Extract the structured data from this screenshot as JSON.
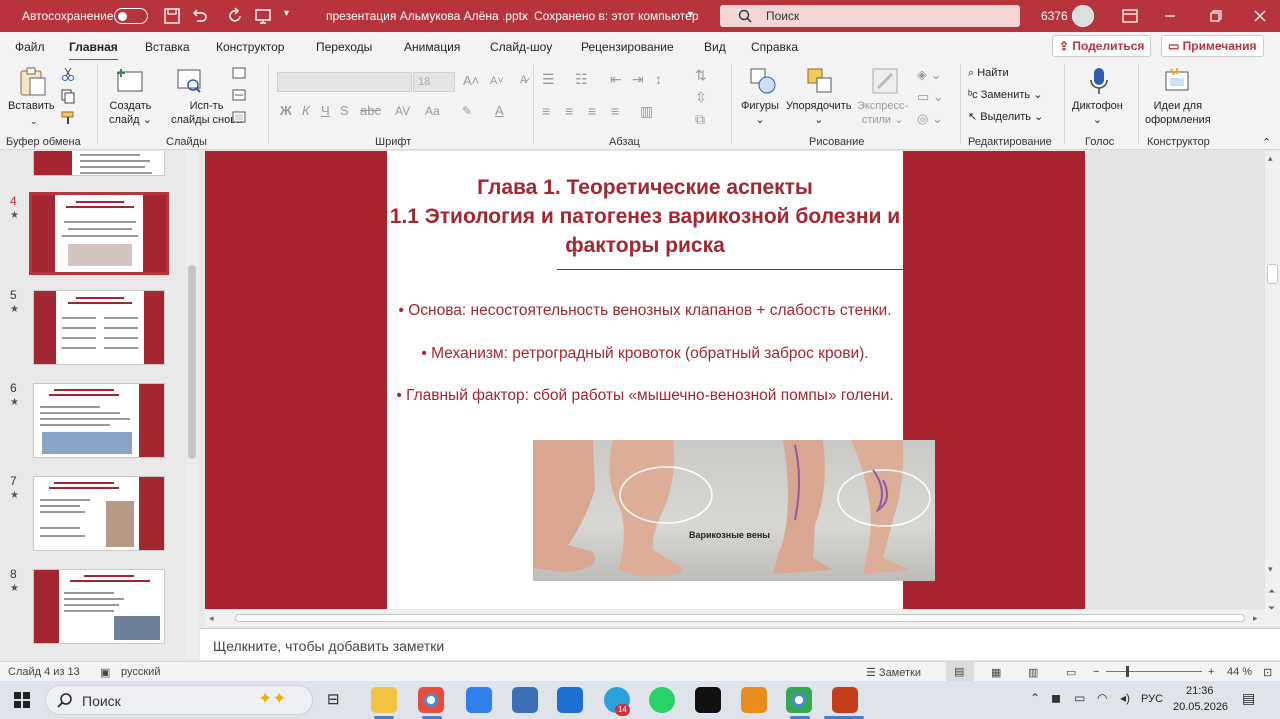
{
  "titlebar": {
    "autosave_label": "Автосохранение",
    "file_title": "презентация Альмукова Алёна .pptx",
    "save_status": "Сохранено в: этот компьютер",
    "search_placeholder": "Поиск",
    "user_count": "6376"
  },
  "menu": {
    "tabs": [
      "Файл",
      "Главная",
      "Вставка",
      "Конструктор",
      "Переходы",
      "Анимация",
      "Слайд-шоу",
      "Рецензирование",
      "Вид",
      "Справка"
    ],
    "share_label": "Поделиться",
    "comments_label": "Примечания"
  },
  "ribbon": {
    "paste": "Вставить",
    "new_slide": [
      "Создать",
      "слайд"
    ],
    "reuse_slides": [
      "Исп-ть",
      "слайды снова"
    ],
    "font_size": "18",
    "shapes": "Фигуры",
    "arrange": "Упорядочить",
    "quick_styles": [
      "Экспресс-",
      "стили"
    ],
    "find": "Найти",
    "replace": "Заменить",
    "select": "Выделить",
    "dictate": "Диктофон",
    "design_ideas": [
      "Идеи для",
      "оформления"
    ],
    "groups": {
      "clipboard": "Буфер обмена",
      "slides": "Слайды",
      "font": "Шрифт",
      "paragraph": "Абзац",
      "drawing": "Рисование",
      "editing": "Редактирование",
      "voice": "Голос",
      "designer": "Конструктор"
    }
  },
  "thumbnails": [
    {
      "num": "4"
    },
    {
      "num": "5"
    },
    {
      "num": "6"
    },
    {
      "num": "7"
    },
    {
      "num": "8"
    }
  ],
  "slide": {
    "title_lines": [
      "Глава 1. Теоретические аспекты",
      "1.1 Этиология и патогенез варикозной болезни и",
      "факторы риска"
    ],
    "bullets": [
      "• Основа: несостоятельность венозных клапанов + слабость стенки.",
      "• Механизм: ретроградный кровоток (обратный заброс крови).",
      "• Главный фактор: сбой работы «мышечно-венозной помпы» голени."
    ],
    "image_caption": "Варикозные вены"
  },
  "notes_placeholder": "Щелкните, чтобы добавить заметки",
  "status": {
    "slide_counter": "Слайд 4 из 13",
    "language": "русский",
    "notes_button": "Заметки",
    "zoom": "44 %"
  },
  "taskbar": {
    "search_label": "Поиск",
    "input_lang": "РУС",
    "time": "21:36",
    "date": "20.05.2026",
    "telegram_badge": "14"
  },
  "colors": {
    "accent": "#b7343d",
    "slide_red": "#a8242e",
    "text_red": "#a32630"
  }
}
